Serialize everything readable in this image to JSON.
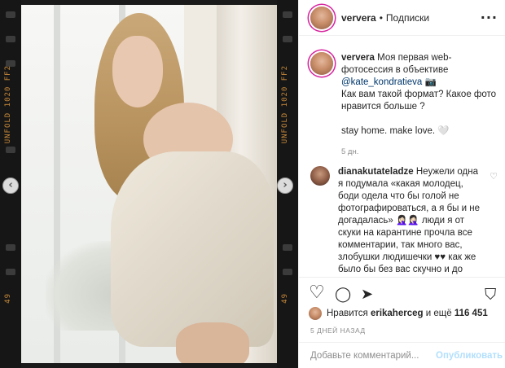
{
  "photo": {
    "film_text_left": "UNFOLD 1020 FF2",
    "film_text_left_2": "49",
    "film_text_right": "UNFOLD 1020 FF2",
    "film_text_right_2": "49",
    "prev_arrow": "‹",
    "next_arrow": "›"
  },
  "header": {
    "username": "ververa",
    "separator": "•",
    "follow_label": "Подписки",
    "more_icon": "···"
  },
  "caption": {
    "username": "ververa",
    "text_1": "Моя первая web-фотосессия в объективе",
    "mention": "@kate_kondratieva",
    "emoji_1": "📷",
    "text_2": "Как вам такой формат? Какое фото нравится больше ?",
    "text_3": "stay home. make love.",
    "emoji_2": "🤍",
    "time": "5 дн."
  },
  "comment": {
    "username": "dianakutateladze",
    "text": "Неужели одна я подумала «какая молодец, боди одела что бы голой не фотографироваться, а я бы и не догадалась» 🤦🏻‍♀️🤦🏻‍♀️ люди я от скуки на карантине прочла все комментарии, так много вас, злобушки людишечки ♥♥ как же было бы без вас скучно и до безобразия хорошо и",
    "like_icon": "♡"
  },
  "actions": {
    "like_icon": "♡",
    "comment_icon": "◯",
    "share_icon": "➤",
    "save_icon": "⛉"
  },
  "likes": {
    "prefix": "Нравится",
    "user": "erikaherceg",
    "suffix": "и ещё",
    "count": "116 451"
  },
  "date_label": "5 ДНЕЙ НАЗАД",
  "add_comment": {
    "placeholder": "Добавьте комментарий...",
    "publish_label": "Опубликовать"
  }
}
